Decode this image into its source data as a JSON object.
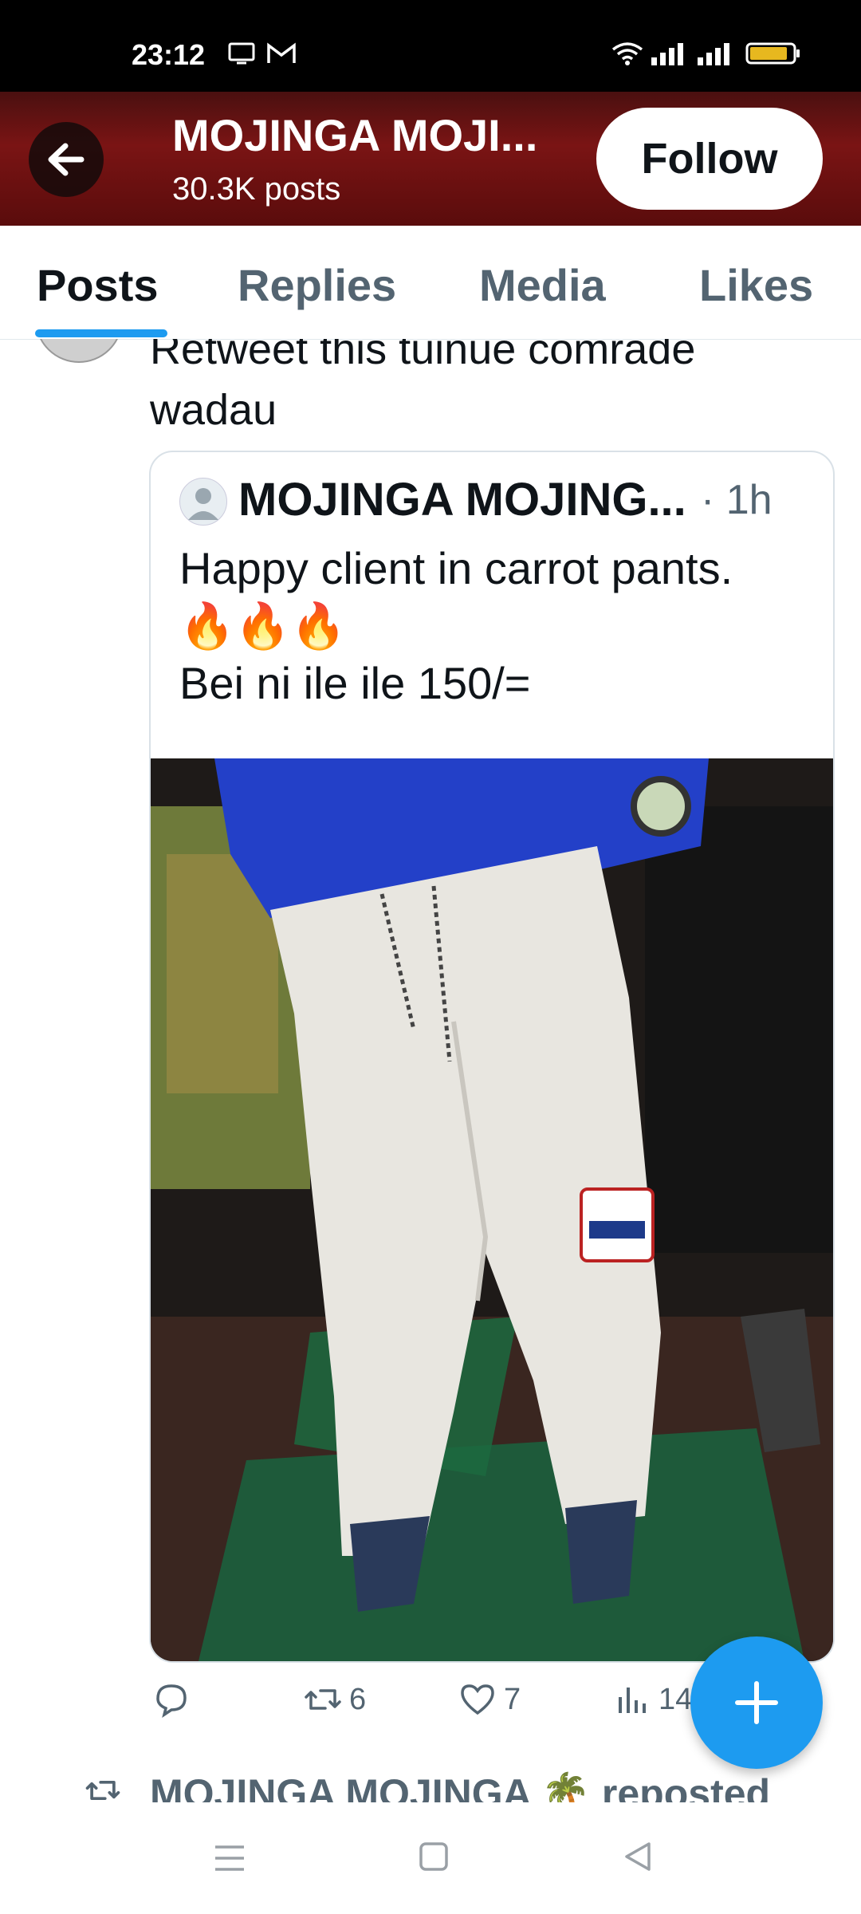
{
  "status_bar": {
    "time": "23:12"
  },
  "header": {
    "title": "MOJINGA MOJI...",
    "posts_count": "30.3K posts",
    "follow_label": "Follow"
  },
  "tabs": [
    {
      "label": "Posts",
      "active": true
    },
    {
      "label": "Replies",
      "active": false
    },
    {
      "label": "Media",
      "active": false
    },
    {
      "label": "Likes",
      "active": false
    }
  ],
  "post": {
    "text": "Retweet this tuinue comrade wadau",
    "quote": {
      "author": "MOJINGA MOJING...",
      "time": "· 1h",
      "line1": "Happy client in carrot pants.",
      "emoji": "🔥🔥🔥",
      "line2": "Bei ni ile ile 150/="
    },
    "actions": {
      "reply_count": "",
      "repost_count": "6",
      "like_count": "7",
      "views_count": "14"
    }
  },
  "next_item": {
    "repost_label": "MOJINGA MOJINGA 🌴 reposted"
  },
  "colors": {
    "accent": "#1d9bf0",
    "header_bg": "#6a1212",
    "text_secondary": "#536471"
  }
}
